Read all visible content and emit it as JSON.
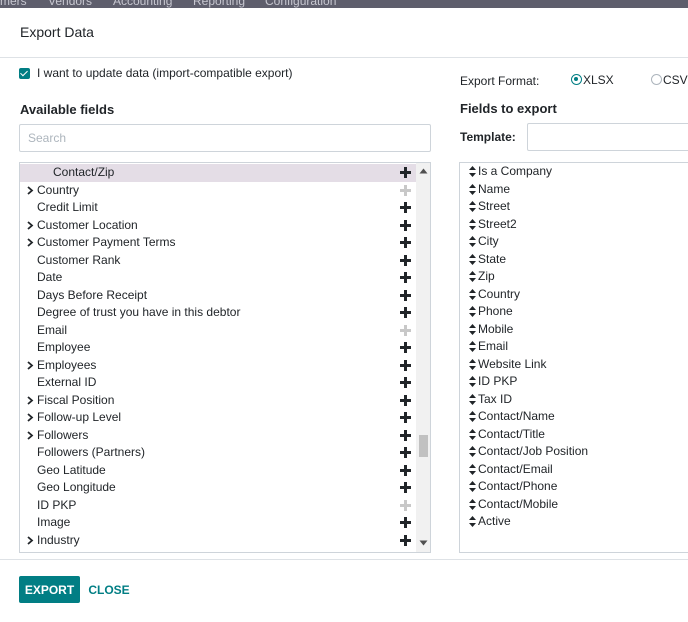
{
  "background_nav": {
    "items": [
      "mers",
      "Vendors",
      "Accounting",
      "Reporting",
      "Configuration"
    ]
  },
  "dialog": {
    "title": "Export Data",
    "import_compatible_label": "I want to update data (import-compatible export)",
    "import_compatible_checked": true,
    "available_fields_title": "Available fields",
    "search_placeholder": "Search",
    "export_format_label": "Export Format:",
    "formats": [
      {
        "label": "XLSX",
        "selected": true
      },
      {
        "label": "CSV",
        "selected": false
      }
    ],
    "fields_to_export_title": "Fields to export",
    "template_label": "Template:",
    "template_value": ""
  },
  "available_fields": [
    {
      "label": "Contact/Zip",
      "expandable": false,
      "selected": true,
      "addable": true
    },
    {
      "label": "Country",
      "expandable": true,
      "selected": false,
      "addable": false
    },
    {
      "label": "Credit Limit",
      "expandable": false,
      "selected": false,
      "addable": true
    },
    {
      "label": "Customer Location",
      "expandable": true,
      "selected": false,
      "addable": true
    },
    {
      "label": "Customer Payment Terms",
      "expandable": true,
      "selected": false,
      "addable": true
    },
    {
      "label": "Customer Rank",
      "expandable": false,
      "selected": false,
      "addable": true
    },
    {
      "label": "Date",
      "expandable": false,
      "selected": false,
      "addable": true
    },
    {
      "label": "Days Before Receipt",
      "expandable": false,
      "selected": false,
      "addable": true
    },
    {
      "label": "Degree of trust you have in this debtor",
      "expandable": false,
      "selected": false,
      "addable": true
    },
    {
      "label": "Email",
      "expandable": false,
      "selected": false,
      "addable": false
    },
    {
      "label": "Employee",
      "expandable": false,
      "selected": false,
      "addable": true
    },
    {
      "label": "Employees",
      "expandable": true,
      "selected": false,
      "addable": true
    },
    {
      "label": "External ID",
      "expandable": false,
      "selected": false,
      "addable": true
    },
    {
      "label": "Fiscal Position",
      "expandable": true,
      "selected": false,
      "addable": true
    },
    {
      "label": "Follow-up Level",
      "expandable": true,
      "selected": false,
      "addable": true
    },
    {
      "label": "Followers",
      "expandable": true,
      "selected": false,
      "addable": true
    },
    {
      "label": "Followers (Partners)",
      "expandable": false,
      "selected": false,
      "addable": true
    },
    {
      "label": "Geo Latitude",
      "expandable": false,
      "selected": false,
      "addable": true
    },
    {
      "label": "Geo Longitude",
      "expandable": false,
      "selected": false,
      "addable": true
    },
    {
      "label": "ID PKP",
      "expandable": false,
      "selected": false,
      "addable": false
    },
    {
      "label": "Image",
      "expandable": false,
      "selected": false,
      "addable": true
    },
    {
      "label": "Industry",
      "expandable": true,
      "selected": false,
      "addable": true
    }
  ],
  "export_fields": [
    "Is a Company",
    "Name",
    "Street",
    "Street2",
    "City",
    "State",
    "Zip",
    "Country",
    "Phone",
    "Mobile",
    "Email",
    "Website Link",
    "ID PKP",
    "Tax ID",
    "Contact/Name",
    "Contact/Title",
    "Contact/Job Position",
    "Contact/Email",
    "Contact/Phone",
    "Contact/Mobile",
    "Active"
  ],
  "footer": {
    "export_label": "EXPORT",
    "close_label": "CLOSE"
  },
  "colors": {
    "accent": "#017e84",
    "selected_row": "#e4dde6",
    "plus_active": "#212529",
    "plus_disabled": "#c8c8c8"
  }
}
